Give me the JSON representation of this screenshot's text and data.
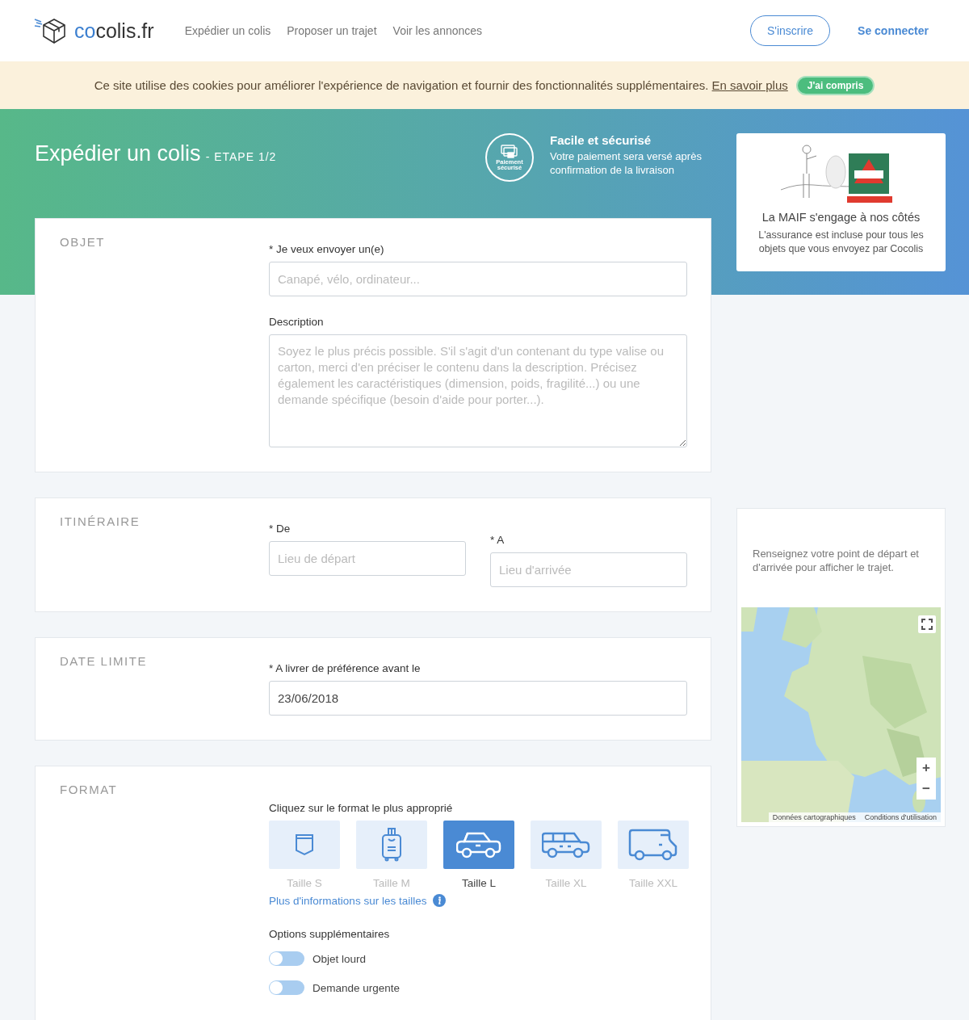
{
  "header": {
    "logo": {
      "accent": "co",
      "rest": "colis.fr"
    },
    "nav": [
      "Expédier un colis",
      "Proposer un trajet",
      "Voir les annonces"
    ],
    "signup": "S'inscrire",
    "login": "Se connecter"
  },
  "cookie": {
    "text": "Ce site utilise des cookies pour améliorer l'expérience de navigation et fournir des fonctionnalités supplémentaires.",
    "link": "En savoir plus",
    "button": "J'ai compris"
  },
  "hero": {
    "title": "Expédier un colis",
    "step": "- ETAPE 1/2",
    "badge": "Paiement sécurisé",
    "secure_title": "Facile et sécurisé",
    "secure_text": "Votre paiement sera versé après confirmation de la livraison"
  },
  "insurance": {
    "title": "La MAIF s'engage à nos côtés",
    "text": "L'assurance est incluse pour tous les objets que vous envoyez par Cocolis"
  },
  "sections": [
    {
      "kind": "fields",
      "title": "OBJET",
      "fields": [
        {
          "kind": "input",
          "label": "* Je veux envoyer un(e)",
          "placeholder": "Canapé, vélo, ordinateur..."
        },
        {
          "kind": "textarea",
          "label": "Description",
          "placeholder": "Soyez le plus précis possible. S'il s'agit d'un contenant du type valise ou carton, merci d'en préciser le contenu dans la description. Précisez également les caractéristiques (dimension, poids, fragilité...) ou une demande spécifique (besoin d'aide pour porter...)."
        }
      ]
    },
    {
      "kind": "pair",
      "title": "ITINÉRAIRE",
      "fields": [
        {
          "kind": "input",
          "label": "* De",
          "placeholder": "Lieu de départ"
        },
        {
          "kind": "input",
          "label": "* A",
          "placeholder": "Lieu d'arrivée"
        }
      ]
    },
    {
      "kind": "fields",
      "title": "DATE LIMITE",
      "fields": [
        {
          "kind": "input",
          "label": "* A livrer de préférence avant le",
          "value": "23/06/2018"
        }
      ]
    },
    {
      "kind": "format",
      "title": "FORMAT",
      "prompt": "Cliquez sur le format le plus approprié",
      "sizes": [
        {
          "kind": "pocket",
          "label": "Taille S",
          "selected": false
        },
        {
          "kind": "suitcase",
          "label": "Taille M",
          "selected": false
        },
        {
          "kind": "car",
          "label": "Taille L",
          "selected": true
        },
        {
          "kind": "minivan",
          "label": "Taille XL",
          "selected": false
        },
        {
          "kind": "van",
          "label": "Taille XXL",
          "selected": false
        }
      ],
      "info_link": "Plus d'informations sur les tailles",
      "options_title": "Options supplémentaires",
      "options": [
        {
          "label": "Objet lourd",
          "on": false
        },
        {
          "label": "Demande urgente",
          "on": false
        }
      ]
    }
  ],
  "map": {
    "message": "Renseignez votre point de départ et d'arrivée pour afficher le trajet.",
    "zoom_in": "+",
    "zoom_out": "−",
    "attribution": [
      "Données cartographiques",
      "Conditions d'utilisation"
    ]
  }
}
